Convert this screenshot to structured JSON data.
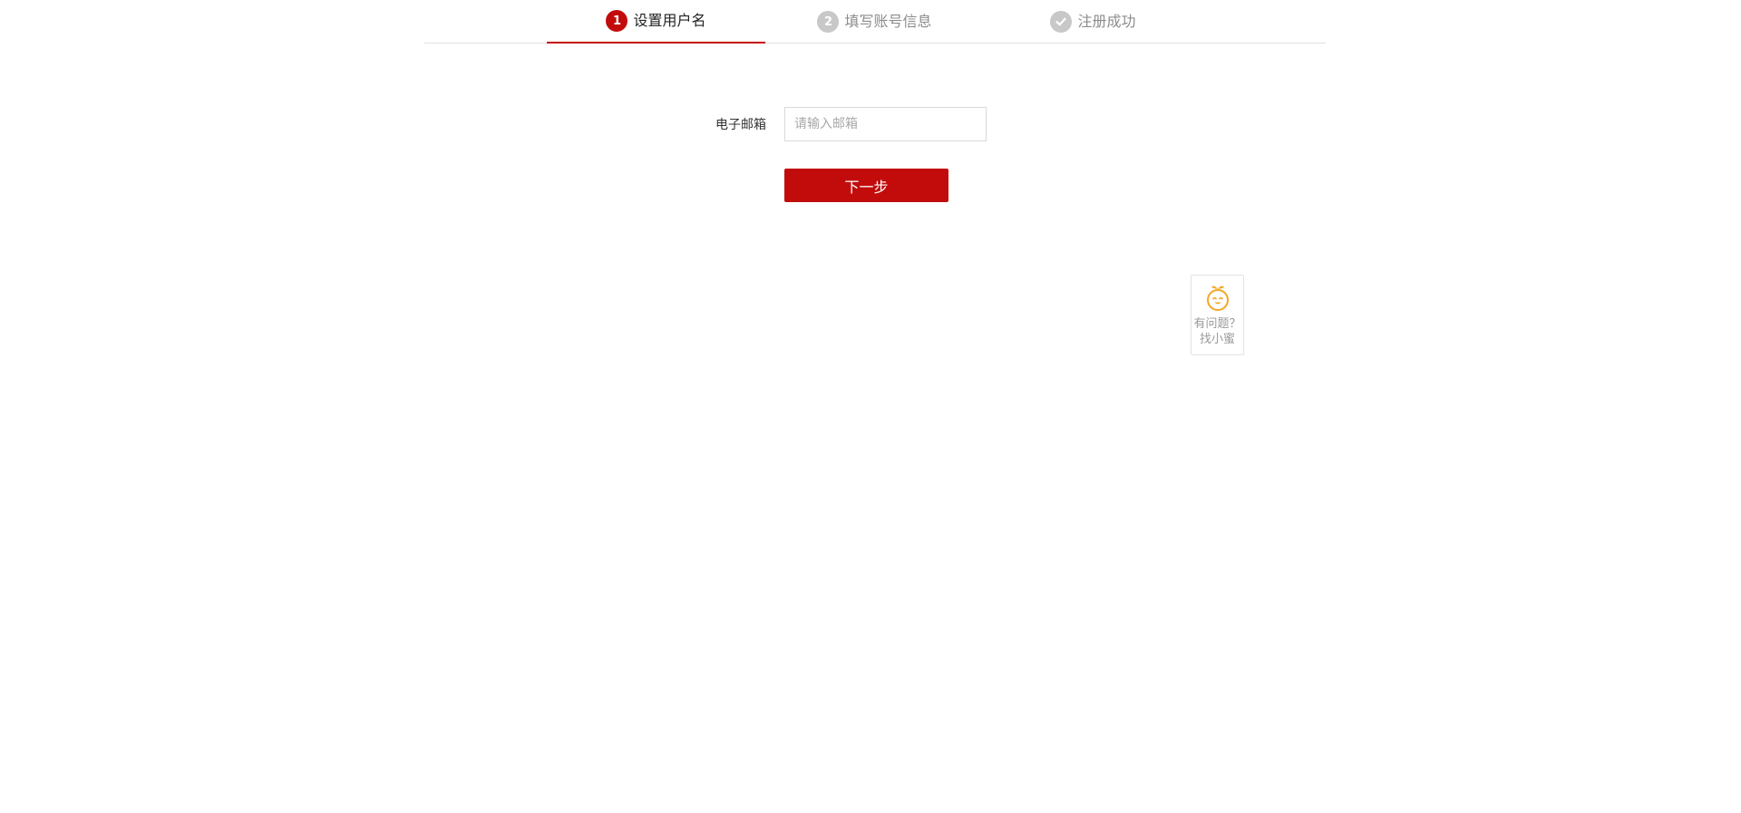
{
  "steps": [
    {
      "number": "1",
      "label": "设置用户名",
      "state": "active"
    },
    {
      "number": "2",
      "label": "填写账号信息",
      "state": "pending"
    },
    {
      "number": "",
      "label": "注册成功",
      "state": "pending",
      "icon": "check-icon"
    }
  ],
  "form": {
    "email_label": "电子邮箱",
    "email_placeholder": "请输入邮箱",
    "email_value": "",
    "next_button_label": "下一步"
  },
  "help": {
    "line1": "有问题？",
    "line2": "找小蜜",
    "icon": "mascot-icon"
  },
  "colors": {
    "accent": "#c20c0c",
    "inactive": "#c8c8c8",
    "mascot": "#f5a623"
  }
}
